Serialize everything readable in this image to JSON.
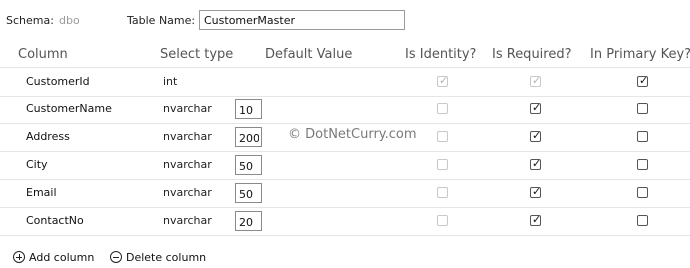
{
  "schema": {
    "label": "Schema:",
    "value": "dbo"
  },
  "table_name": {
    "label": "Table Name:",
    "value": "CustomerMaster"
  },
  "headers": {
    "column": "Column",
    "select_type": "Select type",
    "default_value": "Default Value",
    "is_identity": "Is Identity?",
    "is_required": "Is Required?",
    "in_primary_key": "In Primary Key?"
  },
  "rows": [
    {
      "name": "CustomerId",
      "type": "int",
      "length": "",
      "identity": true,
      "identity_disabled": true,
      "required": true,
      "required_disabled": true,
      "primary_key": true
    },
    {
      "name": "CustomerName",
      "type": "nvarchar",
      "length": "10",
      "identity": false,
      "identity_disabled": true,
      "required": true,
      "required_disabled": false,
      "primary_key": false
    },
    {
      "name": "Address",
      "type": "nvarchar",
      "length": "200",
      "identity": false,
      "identity_disabled": true,
      "required": true,
      "required_disabled": false,
      "primary_key": false
    },
    {
      "name": "City",
      "type": "nvarchar",
      "length": "50",
      "identity": false,
      "identity_disabled": true,
      "required": true,
      "required_disabled": false,
      "primary_key": false
    },
    {
      "name": "Email",
      "type": "nvarchar",
      "length": "50",
      "identity": false,
      "identity_disabled": true,
      "required": true,
      "required_disabled": false,
      "primary_key": false
    },
    {
      "name": "ContactNo",
      "type": "nvarchar",
      "length": "20",
      "identity": false,
      "identity_disabled": true,
      "required": true,
      "required_disabled": false,
      "primary_key": false
    }
  ],
  "watermark": "© DotNetCurry.com",
  "footer": {
    "add_label": "Add column",
    "delete_label": "Delete column"
  }
}
